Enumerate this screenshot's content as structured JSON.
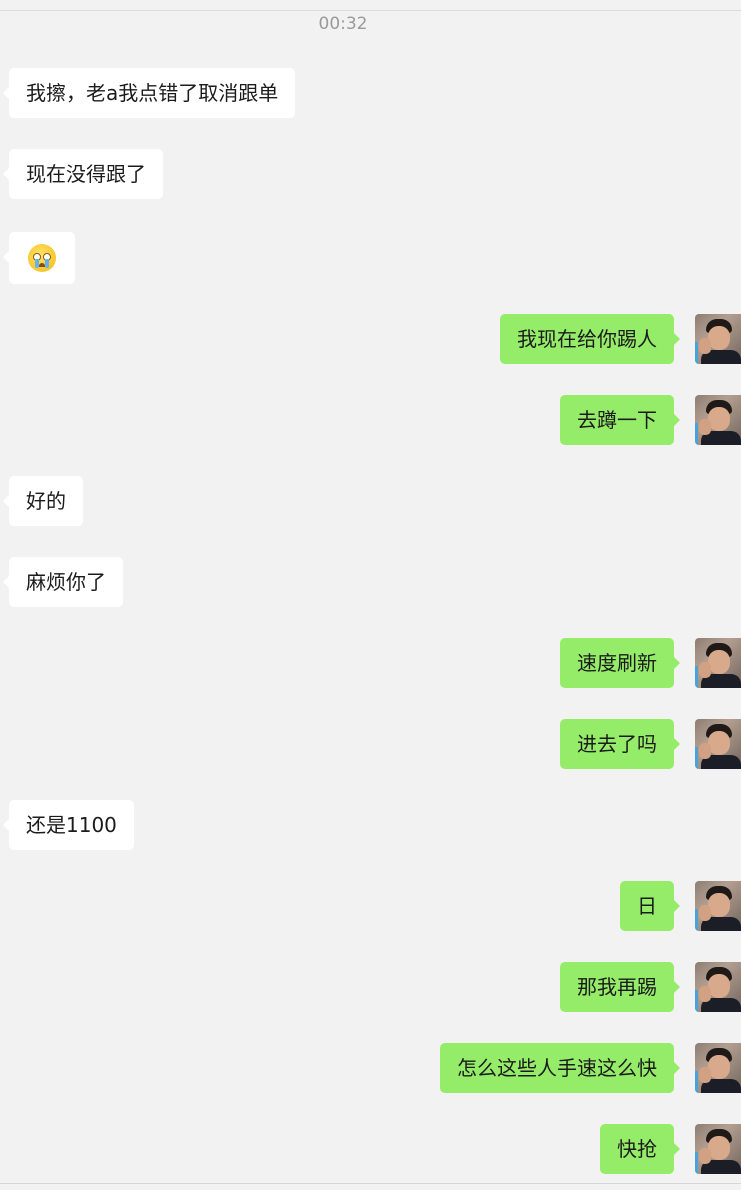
{
  "chat": {
    "timestamp": "00:32",
    "messages": [
      {
        "side": "in",
        "text": "我擦，老a我点错了取消跟单"
      },
      {
        "side": "in",
        "text": "现在没得跟了"
      },
      {
        "side": "in",
        "emoji": "crying-face-emoji"
      },
      {
        "side": "out",
        "text": "我现在给你踢人"
      },
      {
        "side": "out",
        "text": "去蹲一下"
      },
      {
        "side": "in",
        "text": "好的"
      },
      {
        "side": "in",
        "text": "麻烦你了"
      },
      {
        "side": "out",
        "text": "速度刷新"
      },
      {
        "side": "out",
        "text": "进去了吗"
      },
      {
        "side": "in",
        "text": "还是1100"
      },
      {
        "side": "out",
        "text": "日"
      },
      {
        "side": "out",
        "text": "那我再踢"
      },
      {
        "side": "out",
        "text": "怎么这些人手速这么快"
      },
      {
        "side": "out",
        "text": "快抢"
      }
    ]
  },
  "colors": {
    "background": "#f2f2f2",
    "incoming_bubble": "#ffffff",
    "outgoing_bubble": "#95ec69",
    "timestamp_text": "#9a9a9a"
  }
}
